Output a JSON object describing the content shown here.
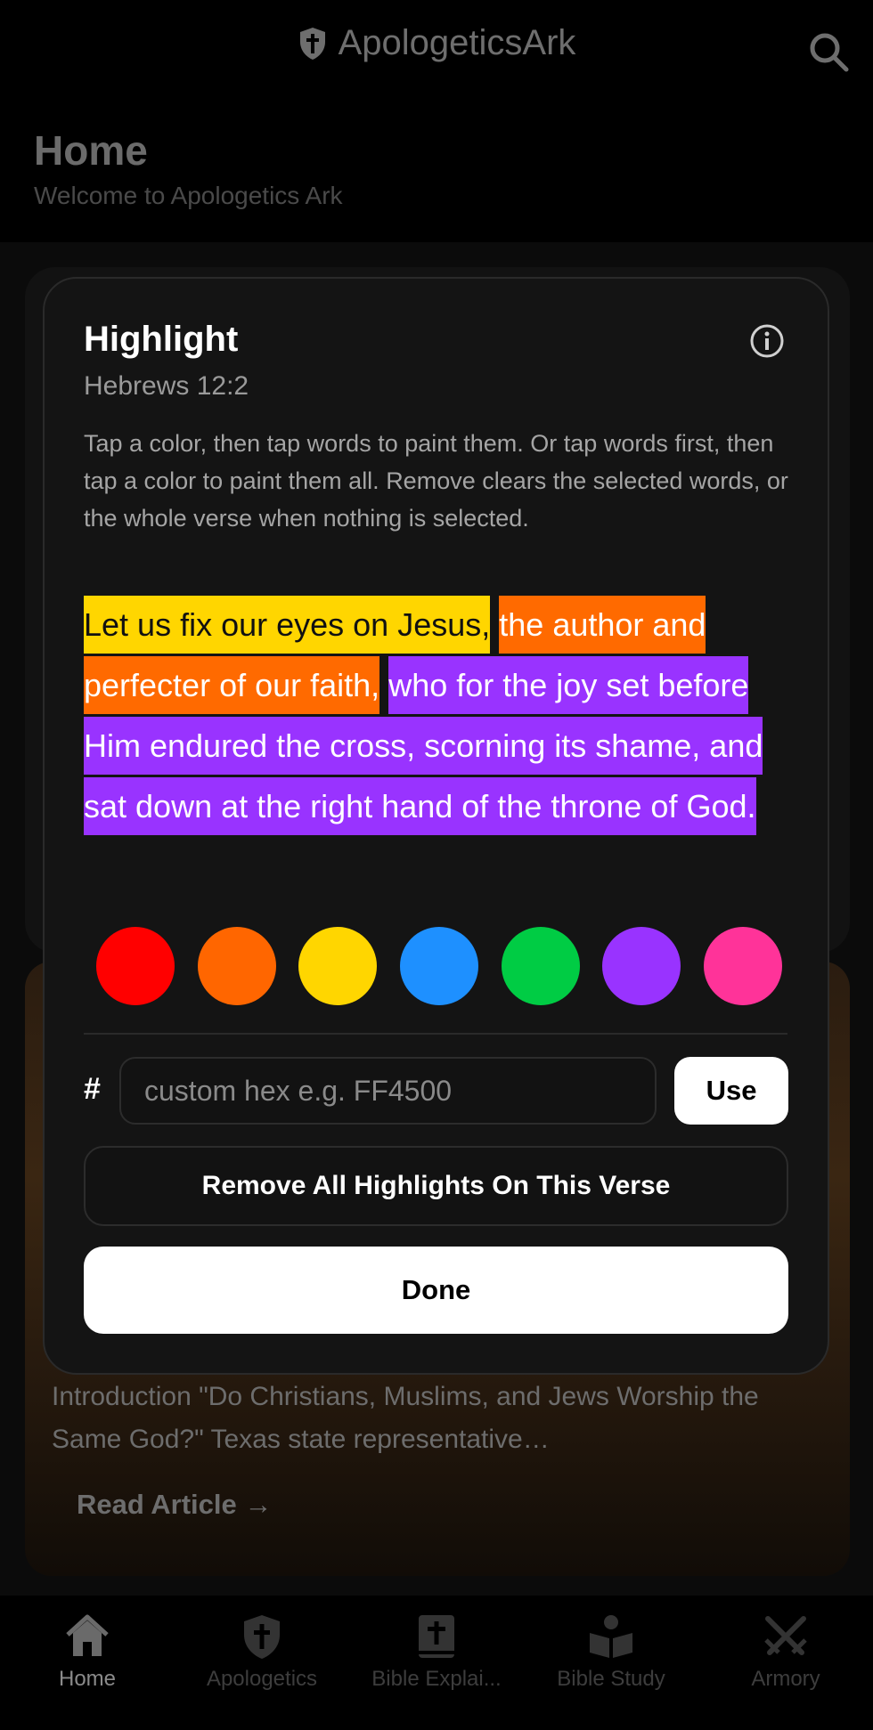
{
  "header": {
    "app_title": "ApologeticsArk",
    "logo_icon": "shield-cross-icon",
    "search_icon": "search-icon"
  },
  "page": {
    "title": "Home",
    "subtitle": "Welcome to Apologetics Ark"
  },
  "article": {
    "excerpt": "Introduction \"Do Christians, Muslims, and Jews Worship the Same God?\" Texas state representative…",
    "read_label": "Read Article →"
  },
  "modal": {
    "title": "Highlight",
    "reference": "Hebrews 12:2",
    "instructions": "Tap a color, then tap words to paint them. Or tap words first, then tap a color to paint them all. Remove clears the selected words, or the whole verse when nothing is selected.",
    "verse_segments": [
      {
        "text": "Let us fix our eyes on Jesus,",
        "color": "#FFD600"
      },
      {
        "text": "the author and perfecter of our faith,",
        "color": "#FF6A00"
      },
      {
        "text": "who for the joy set before Him endured the cross, scorning its shame, and sat down at the right hand of the throne of God.",
        "color": "#9933FF"
      }
    ],
    "swatches": [
      "#FF0000",
      "#FF6600",
      "#FFD600",
      "#1E90FF",
      "#00CC44",
      "#9933FF",
      "#FF3399"
    ],
    "hex_symbol": "#",
    "hex_placeholder": "custom hex e.g. FF4500",
    "use_label": "Use",
    "remove_label": "Remove All Highlights On This Verse",
    "done_label": "Done",
    "info_icon": "info-icon"
  },
  "nav": {
    "items": [
      {
        "label": "Home",
        "icon": "home-icon",
        "active": true
      },
      {
        "label": "Apologetics",
        "icon": "shield-cross-icon",
        "active": false
      },
      {
        "label": "Bible Explai...",
        "icon": "bible-cross-icon",
        "active": false
      },
      {
        "label": "Bible Study",
        "icon": "reader-book-icon",
        "active": false
      },
      {
        "label": "Armory",
        "icon": "crossed-swords-icon",
        "active": false
      }
    ]
  }
}
